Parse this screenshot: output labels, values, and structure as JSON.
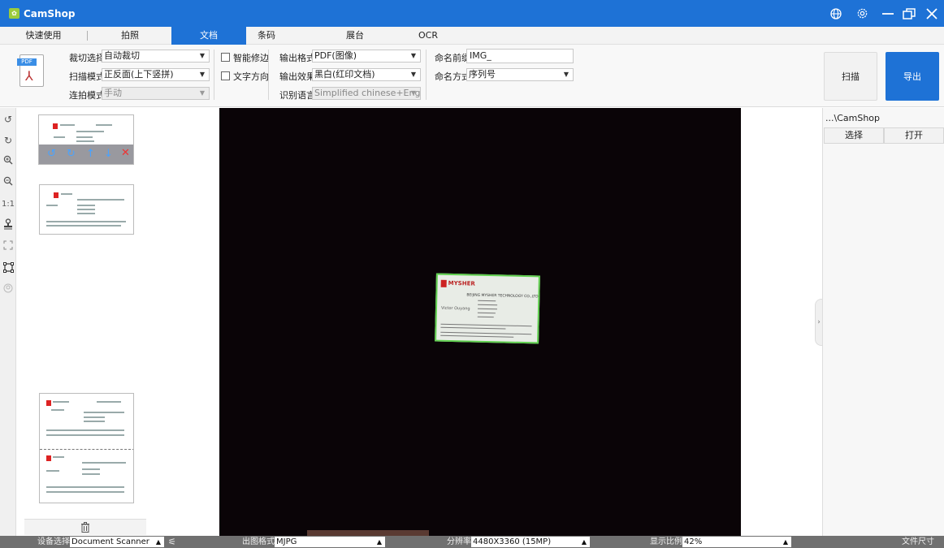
{
  "app": {
    "title": "CamShop",
    "accent": "#1e72d6"
  },
  "tabs": [
    {
      "label": "快速使用"
    },
    {
      "label": "拍照"
    },
    {
      "label": "文档",
      "active": true
    },
    {
      "label": "条码"
    },
    {
      "label": "展台"
    },
    {
      "label": "OCR"
    }
  ],
  "toolbar": {
    "crop_label": "裁切选择",
    "crop_value": "自动裁切",
    "scan_mode_label": "扫描模式",
    "scan_mode_value": "正反面(上下竖拼)",
    "continuous_label": "连拍模式",
    "continuous_value": "手动",
    "smart_edge_label": "智能修边",
    "text_dir_label": "文字方向",
    "output_format_label": "输出格式",
    "output_format_value": "PDF(图像)",
    "output_effect_label": "输出效果",
    "output_effect_value": "黑白(红印文档)",
    "ocr_lang_label": "识别语言",
    "ocr_lang_value": "Simplified chinese+English",
    "name_prefix_label": "命名前缀",
    "name_prefix_value": "IMG_",
    "name_mode_label": "命名方式",
    "name_mode_value": "序列号",
    "scan_button": "扫描",
    "export_button": "导出"
  },
  "card": {
    "brand": "MYSHER",
    "company": "BEIJING MYSHER TECHNOLOGY CO.,LTD",
    "person": "Victor Ouyang"
  },
  "right_panel": {
    "path": "...\\CamShop",
    "select_button": "选择",
    "open_button": "打开"
  },
  "status": {
    "device_label": "设备选择",
    "device_value": "Document Scanner",
    "format_label": "出图格式",
    "format_value": "MJPG",
    "resolution_label": "分辨率",
    "resolution_value": "4480X3360 (15MP)",
    "zoom_label": "显示比例",
    "zoom_value": "42%",
    "filesize_label": "文件尺寸"
  }
}
